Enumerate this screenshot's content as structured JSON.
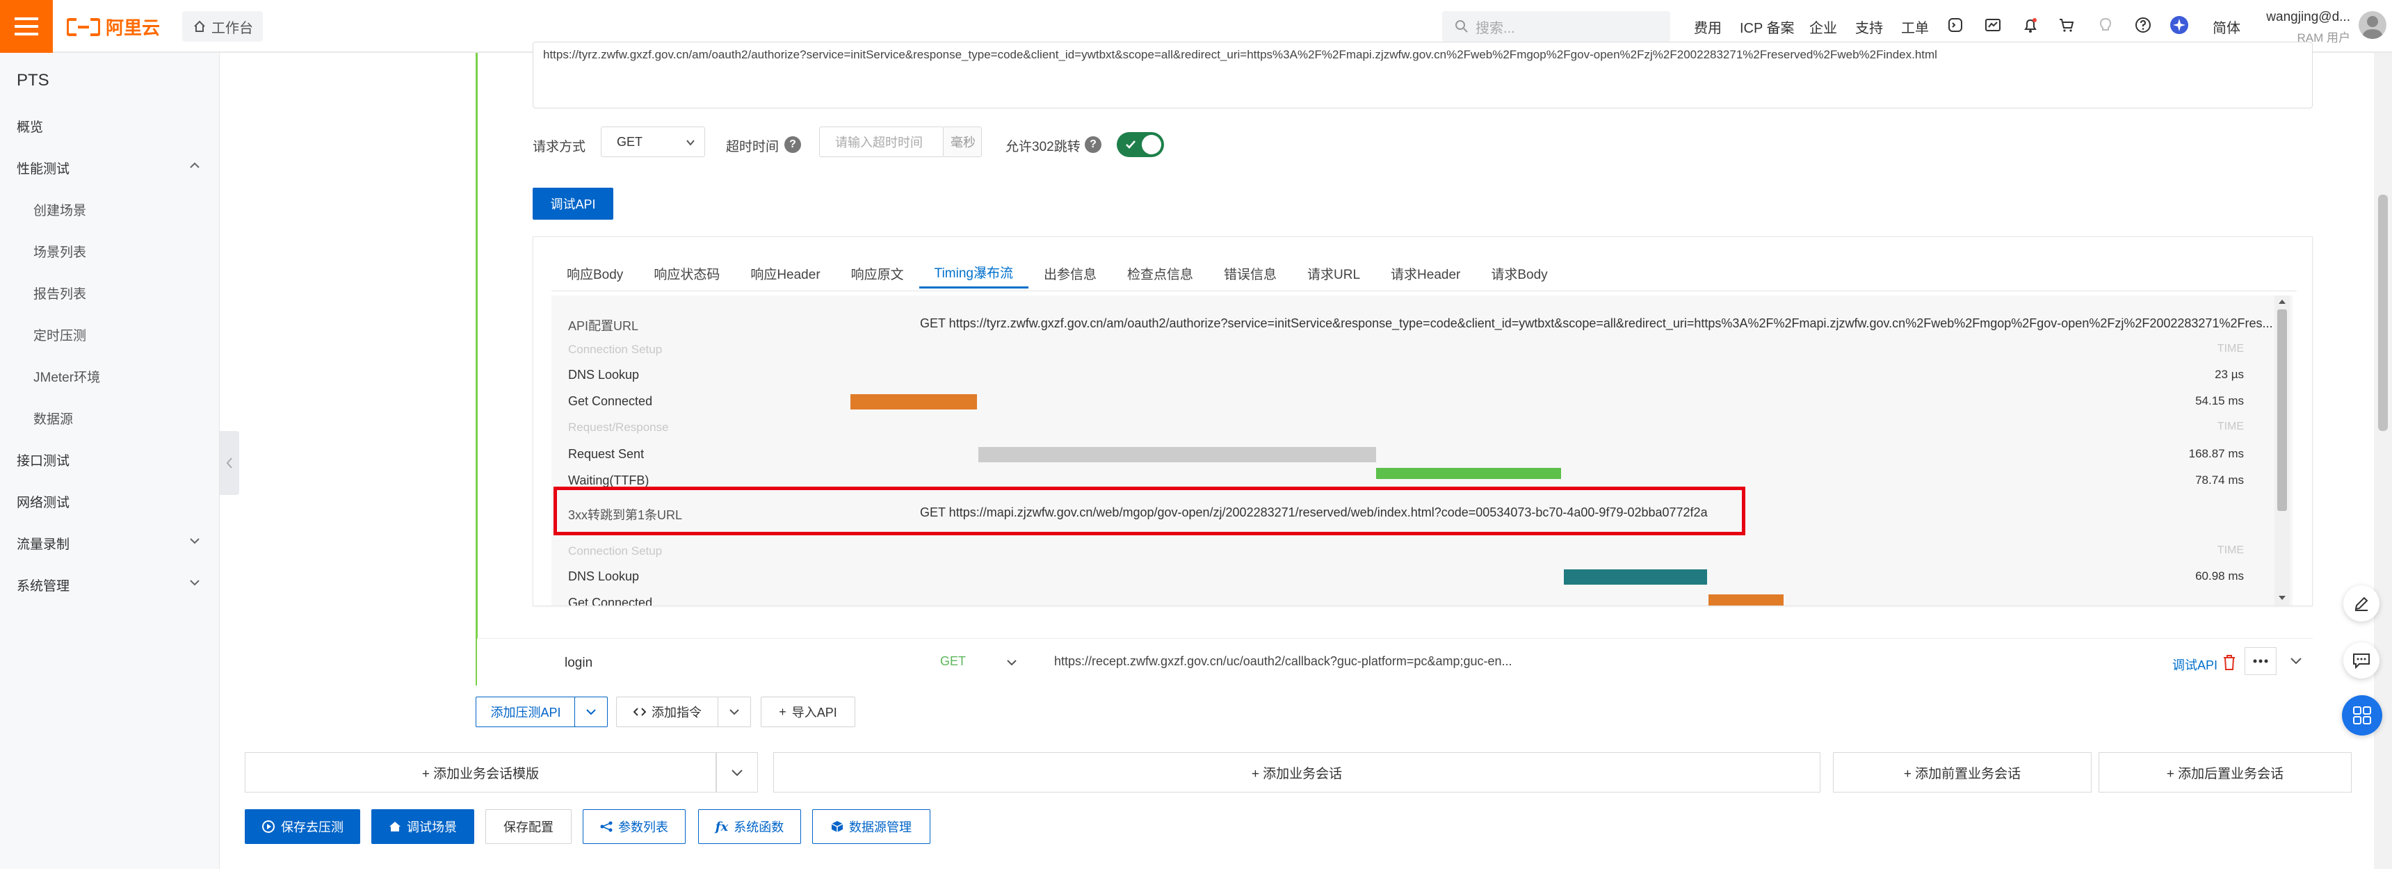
{
  "topbar": {
    "brand": "阿里云",
    "workspace": "工作台",
    "search_placeholder": "搜索...",
    "nav": [
      "费用",
      "ICP 备案",
      "企业",
      "支持",
      "工单"
    ],
    "lang": "简体",
    "user_name": "wangjing@d...",
    "user_role": "RAM 用户",
    "accent": "#ff6a00"
  },
  "sidebar": {
    "title": "PTS",
    "items": [
      "概览",
      "性能测试",
      "接口测试",
      "网络测试",
      "流量录制",
      "系统管理"
    ],
    "sub_items": [
      "创建场景",
      "场景列表",
      "报告列表",
      "定时压测",
      "JMeter环境",
      "数据源"
    ]
  },
  "request": {
    "url": "https://tyrz.zwfw.gxzf.gov.cn/am/oauth2/authorize?service=initService&response_type=code&client_id=ywtbxt&scope=all&redirect_uri=https%3A%2F%2Fmapi.zjzwfw.gov.cn%2Fweb%2Fmgop%2Fgov-open%2Fzj%2F2002283271%2Freserved%2Fweb%2Findex.html",
    "method_label": "请求方式",
    "method": "GET",
    "timeout_label": "超时时间",
    "timeout_placeholder": "请输入超时时间",
    "timeout_unit": "毫秒",
    "redirect_label": "允许302跳转",
    "redirect_enabled": true,
    "test_button": "调试API"
  },
  "response_tabs": [
    "响应Body",
    "响应状态码",
    "响应Header",
    "响应原文",
    "Timing瀑布流",
    "出参信息",
    "检查点信息",
    "错误信息",
    "请求URL",
    "请求Header",
    "请求Body"
  ],
  "active_tab": "Timing瀑布流",
  "timing": {
    "api_url_label": "API配置URL",
    "api_url": "GET https://tyrz.zwfw.gxzf.gov.cn/am/oauth2/authorize?service=initService&response_type=code&client_id=ywtbxt&scope=all&redirect_uri=https%3A%2F%2Fmapi.zjzwfw.gov.cn%2Fweb%2Fmgop%2Fgov-open%2Fzj%2F2002283271%2Fres...",
    "section_connection": "Connection Setup",
    "section_request": "Request/Response",
    "time_header": "TIME",
    "dns_label": "DNS Lookup",
    "dns_time": "23 µs",
    "connected_label": "Get Connected",
    "connected_time": "54.15 ms",
    "sent_label": "Request Sent",
    "sent_time": "168.87 ms",
    "waiting_label": "Waiting(TTFB)",
    "waiting_time": "78.74 ms",
    "redirect_label": "3xx转跳到第1条URL",
    "redirect_url": "GET https://mapi.zjzwfw.gov.cn/web/mgop/gov-open/zj/2002283271/reserved/web/index.html?code=00534073-bc70-4a00-9f79-02bba0772f2a",
    "dns2_label": "DNS Lookup",
    "dns2_time": "60.98 ms",
    "connected2_label": "Get Connected",
    "bar_colors": {
      "connected": "#e07b28",
      "sent": "#cccccc",
      "waiting": "#5cc04a",
      "dns2": "#217a80"
    }
  },
  "login_row": {
    "name": "login",
    "method": "GET",
    "url": "https://recept.zwfw.gxzf.gov.cn/uc/oauth2/callback?guc-platform=pc&amp;guc-en...",
    "debug": "调试API"
  },
  "actions": {
    "add_api": "添加压测API",
    "add_cmd": "添加指令",
    "import_api": "导入API"
  },
  "session_buttons": [
    "+ 添加业务会话模版",
    "+ 添加业务会话",
    "+ 添加前置业务会话",
    "+ 添加后置业务会话"
  ],
  "footer": {
    "save_test": "保存去压测",
    "debug_scene": "调试场景",
    "save_config": "保存配置",
    "params": "参数列表",
    "functions": "系统函数",
    "datasource": "数据源管理"
  }
}
